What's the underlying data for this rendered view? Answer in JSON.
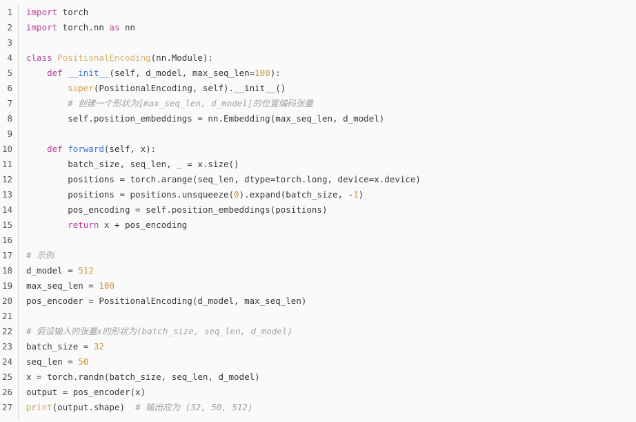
{
  "editor": {
    "language": "python",
    "background_color": "#fafafa",
    "gutter_color": "#555555",
    "divider_color": "#d8d8d8",
    "default_text_color": "#383838",
    "keyword_color": "#b5409a",
    "function_color": "#3b78c8",
    "class_color": "#d8b06a",
    "builtin_color": "#d2a24c",
    "number_color": "#c8953c",
    "comment_color": "#a0a0a0",
    "line_numbers": [
      "1",
      "2",
      "3",
      "4",
      "5",
      "6",
      "7",
      "8",
      "9",
      "10",
      "11",
      "12",
      "13",
      "14",
      "15",
      "16",
      "17",
      "18",
      "19",
      "20",
      "21",
      "22",
      "23",
      "24",
      "25",
      "26",
      "27"
    ],
    "lines": [
      {
        "n": "1",
        "tokens": [
          {
            "t": "import",
            "c": "kw"
          },
          {
            "t": " torch",
            "c": "pl"
          }
        ]
      },
      {
        "n": "2",
        "tokens": [
          {
            "t": "import",
            "c": "kw"
          },
          {
            "t": " torch.nn ",
            "c": "pl"
          },
          {
            "t": "as",
            "c": "kw"
          },
          {
            "t": " nn",
            "c": "pl"
          }
        ]
      },
      {
        "n": "3",
        "tokens": []
      },
      {
        "n": "4",
        "tokens": [
          {
            "t": "class",
            "c": "kw"
          },
          {
            "t": " ",
            "c": "pl"
          },
          {
            "t": "PositionalEncoding",
            "c": "cls"
          },
          {
            "t": "(nn.Module):",
            "c": "pl"
          }
        ]
      },
      {
        "n": "5",
        "tokens": [
          {
            "t": "    ",
            "c": "pl"
          },
          {
            "t": "def",
            "c": "kw"
          },
          {
            "t": " ",
            "c": "pl"
          },
          {
            "t": "__init__",
            "c": "fnc"
          },
          {
            "t": "(self, d_model, max_seq_len=",
            "c": "pl"
          },
          {
            "t": "100",
            "c": "num"
          },
          {
            "t": "):",
            "c": "pl"
          }
        ]
      },
      {
        "n": "6",
        "tokens": [
          {
            "t": "        ",
            "c": "pl"
          },
          {
            "t": "super",
            "c": "bi"
          },
          {
            "t": "(PositionalEncoding, self).__init__()",
            "c": "pl"
          }
        ]
      },
      {
        "n": "7",
        "tokens": [
          {
            "t": "        ",
            "c": "pl"
          },
          {
            "t": "# 创建一个形状为[max_seq_len, d_model]的位置编码张量",
            "c": "cmt"
          }
        ]
      },
      {
        "n": "8",
        "tokens": [
          {
            "t": "        self.position_embeddings = nn.Embedding(max_seq_len, d_model)",
            "c": "pl"
          }
        ]
      },
      {
        "n": "9",
        "tokens": []
      },
      {
        "n": "10",
        "tokens": [
          {
            "t": "    ",
            "c": "pl"
          },
          {
            "t": "def",
            "c": "kw"
          },
          {
            "t": " ",
            "c": "pl"
          },
          {
            "t": "forward",
            "c": "fnc"
          },
          {
            "t": "(self, x):",
            "c": "pl"
          }
        ]
      },
      {
        "n": "11",
        "tokens": [
          {
            "t": "        batch_size, seq_len, _ = x.size()",
            "c": "pl"
          }
        ]
      },
      {
        "n": "12",
        "tokens": [
          {
            "t": "        positions = torch.arange(seq_len, dtype=torch.long, device=x.device)",
            "c": "pl"
          }
        ]
      },
      {
        "n": "13",
        "tokens": [
          {
            "t": "        positions = positions.unsqueeze(",
            "c": "pl"
          },
          {
            "t": "0",
            "c": "num"
          },
          {
            "t": ").expand(batch_size, -",
            "c": "pl"
          },
          {
            "t": "1",
            "c": "num"
          },
          {
            "t": ")",
            "c": "pl"
          }
        ]
      },
      {
        "n": "14",
        "tokens": [
          {
            "t": "        pos_encoding = self.position_embeddings(positions)",
            "c": "pl"
          }
        ]
      },
      {
        "n": "15",
        "tokens": [
          {
            "t": "        ",
            "c": "pl"
          },
          {
            "t": "return",
            "c": "kw"
          },
          {
            "t": " x + pos_encoding",
            "c": "pl"
          }
        ]
      },
      {
        "n": "16",
        "tokens": []
      },
      {
        "n": "17",
        "tokens": [
          {
            "t": "# 示例",
            "c": "cmt"
          }
        ]
      },
      {
        "n": "18",
        "tokens": [
          {
            "t": "d_model = ",
            "c": "pl"
          },
          {
            "t": "512",
            "c": "num"
          }
        ]
      },
      {
        "n": "19",
        "tokens": [
          {
            "t": "max_seq_len = ",
            "c": "pl"
          },
          {
            "t": "100",
            "c": "num"
          }
        ]
      },
      {
        "n": "20",
        "tokens": [
          {
            "t": "pos_encoder = PositionalEncoding(d_model, max_seq_len)",
            "c": "pl"
          }
        ]
      },
      {
        "n": "21",
        "tokens": []
      },
      {
        "n": "22",
        "tokens": [
          {
            "t": "# 假设输入的张量x的形状为(batch_size, seq_len, d_model)",
            "c": "cmt"
          }
        ]
      },
      {
        "n": "23",
        "tokens": [
          {
            "t": "batch_size = ",
            "c": "pl"
          },
          {
            "t": "32",
            "c": "num"
          }
        ]
      },
      {
        "n": "24",
        "tokens": [
          {
            "t": "seq_len = ",
            "c": "pl"
          },
          {
            "t": "50",
            "c": "num"
          }
        ]
      },
      {
        "n": "25",
        "tokens": [
          {
            "t": "x = torch.randn(batch_size, seq_len, d_model)",
            "c": "pl"
          }
        ]
      },
      {
        "n": "26",
        "tokens": [
          {
            "t": "output = pos_encoder(x)",
            "c": "pl"
          }
        ]
      },
      {
        "n": "27",
        "tokens": [
          {
            "t": "print",
            "c": "bi"
          },
          {
            "t": "(output.shape)  ",
            "c": "pl"
          },
          {
            "t": "# 输出应为 (32, 50, 512)",
            "c": "cmt"
          }
        ]
      }
    ]
  }
}
